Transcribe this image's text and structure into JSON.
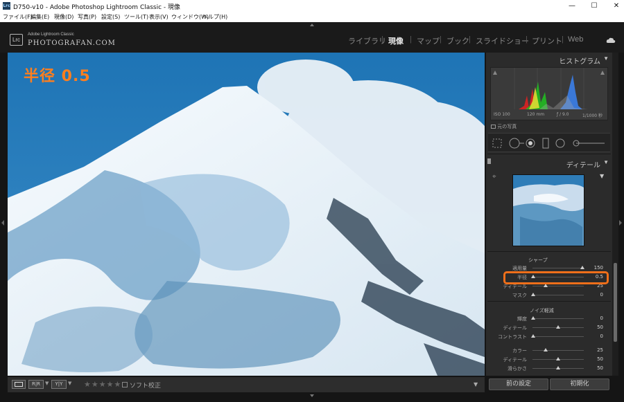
{
  "window": {
    "title": "D750-v10 - Adobe Photoshop Lightroom Classic - 現像",
    "app_icon": "Lrc",
    "controls": [
      "—",
      "☐",
      "✕"
    ]
  },
  "menu": [
    "ファイル(F)",
    "編集(E)",
    "現像(D)",
    "写真(P)",
    "設定(S)",
    "ツール(T)",
    "表示(V)",
    "ウィンドウ(W)",
    "ヘルプ(H)"
  ],
  "identity": {
    "badge": "Lrc",
    "small": "Adobe Lightroom Classic",
    "big": "PHOTOGRAFAN.COM"
  },
  "modules": [
    {
      "label": "ライブラリ",
      "active": false
    },
    {
      "label": "現像",
      "active": true
    },
    {
      "label": "マップ",
      "active": false
    },
    {
      "label": "ブック",
      "active": false
    },
    {
      "label": "スライドショー",
      "active": false
    },
    {
      "label": "プリント",
      "active": false
    },
    {
      "label": "Web",
      "active": false
    }
  ],
  "annotation": "半径 0.5",
  "histogram": {
    "title": "ヒストグラム",
    "iso": "ISO 100",
    "focal": "120 mm",
    "aperture": "ƒ / 9.0",
    "shutter": "1/1000 秒",
    "original_label": "元の写真"
  },
  "detail": {
    "title": "ディテール",
    "sharpen_title": "シャープ",
    "sharpen": [
      {
        "label": "適用量",
        "value": "150",
        "pos": 0.99
      },
      {
        "label": "半径",
        "value": "0.5",
        "pos": 0.0
      },
      {
        "label": "ディテール",
        "value": "25",
        "pos": 0.25
      },
      {
        "label": "マスク",
        "value": "0",
        "pos": 0.0
      }
    ],
    "noise_title": "ノイズ軽減",
    "noise": [
      {
        "label": "輝度",
        "value": "0",
        "pos": 0.0
      },
      {
        "label": "ディテール",
        "value": "50",
        "pos": 0.5
      },
      {
        "label": "コントラスト",
        "value": "0",
        "pos": 0.0
      },
      {
        "label": "カラー",
        "value": "25",
        "pos": 0.25
      },
      {
        "label": "ディテール",
        "value": "50",
        "pos": 0.5
      },
      {
        "label": "滑らかさ",
        "value": "50",
        "pos": 0.5
      }
    ]
  },
  "toolbar": {
    "soft_proof": "ソフト校正",
    "stars": "★★★★★",
    "view_rr": "R|R",
    "view_yy": "Y|Y"
  },
  "buttons": {
    "previous": "前の設定",
    "reset": "初期化"
  },
  "colors": {
    "accent": "#ef6f1a",
    "annotation": "#ff7f1e"
  }
}
